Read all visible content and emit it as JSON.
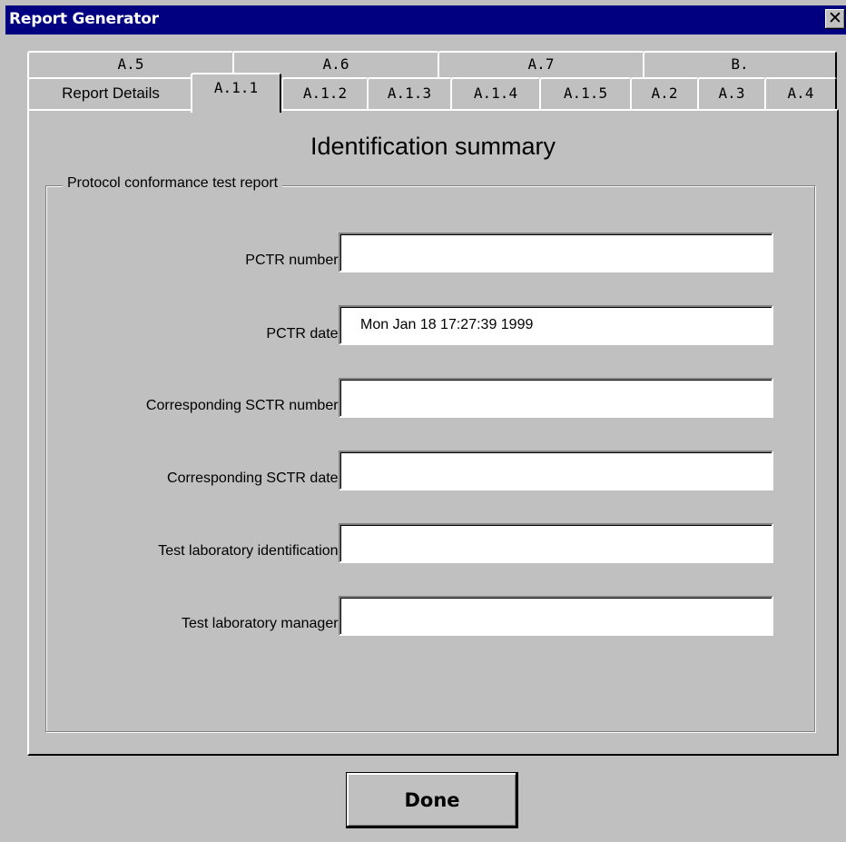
{
  "window": {
    "title": "Report Generator",
    "close_symbol": "✕"
  },
  "tabs": {
    "row1": [
      "A.5",
      "A.6",
      "A.7",
      "B."
    ],
    "row2": [
      "Report Details",
      "A.1.1",
      "A.1.2",
      "A.1.3",
      "A.1.4",
      "A.1.5",
      "A.2",
      "A.3",
      "A.4"
    ],
    "active": "A.1.1"
  },
  "panel": {
    "title": "Identification summary",
    "group_label": "Protocol conformance test report",
    "fields": [
      {
        "label": "PCTR number:",
        "value": ""
      },
      {
        "label": "PCTR date:",
        "value": "Mon Jan 18 17:27:39 1999"
      },
      {
        "label": "Corresponding SCTR number:",
        "value": ""
      },
      {
        "label": "Corresponding SCTR date:",
        "value": ""
      },
      {
        "label": "Test laboratory identification:",
        "value": ""
      },
      {
        "label": "Test laboratory manager:",
        "value": ""
      }
    ]
  },
  "buttons": {
    "done": "Done"
  },
  "icons": {
    "close": "close-icon"
  }
}
